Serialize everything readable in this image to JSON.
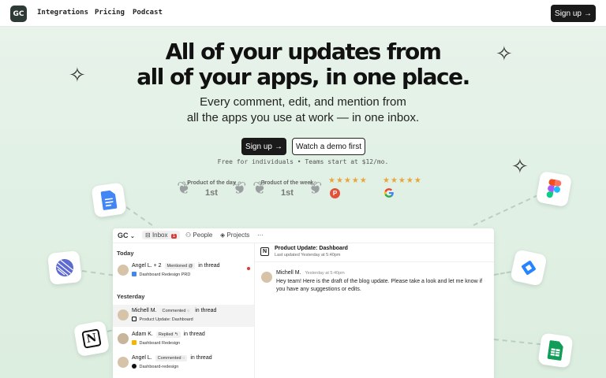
{
  "nav": {
    "logo": "GC",
    "links": [
      "Integrations",
      "Pricing",
      "Podcast"
    ],
    "signup": "Sign up",
    "arrow": "→"
  },
  "hero": {
    "title_line1": "All of your updates from",
    "title_line2": "all of your apps, in one place.",
    "sub_line1": "Every comment, edit, and mention from",
    "sub_line2": "all the apps you use at work — in one inbox.",
    "primary_cta": "Sign up",
    "secondary_cta": "Watch a demo first",
    "pricing_note": "Free for individuals • Teams start at $12/mo."
  },
  "awards": [
    {
      "title": "Product of the day",
      "rank": "1st"
    },
    {
      "title": "Product of the week",
      "rank": "1st"
    }
  ],
  "ratings": [
    {
      "stars": "★★★★★",
      "source_icon": "product-hunt-icon",
      "source_letter": "P"
    },
    {
      "stars": "★★★★★",
      "source_icon": "google-icon"
    }
  ],
  "app": {
    "logo": "GC",
    "tabs": [
      {
        "label": "Inbox",
        "badge": "1"
      },
      {
        "label": "People"
      },
      {
        "label": "Projects"
      }
    ],
    "more": "···",
    "sections": {
      "today": "Today",
      "yesterday": "Yesterday"
    },
    "items": [
      {
        "name": "Angel L. + 2",
        "action": "Mentioned @",
        "suffix": "in thread",
        "doc": "Dashboard Redesign PRD",
        "doc_icon": "google-docs-icon",
        "unread": true
      },
      {
        "name": "Michell M.",
        "action": "Commented ◌",
        "suffix": "in thread",
        "doc": "Product Update: Dashboard",
        "doc_icon": "notion-icon",
        "unread": false
      },
      {
        "name": "Adam K.",
        "action": "Replied ↰",
        "suffix": "in thread",
        "doc": "Dashboard Redesign",
        "doc_icon": "google-slides-icon",
        "unread": false
      },
      {
        "name": "Angel L.",
        "action": "Commented ◌",
        "suffix": "in thread",
        "doc": "Dashboard-redesign",
        "doc_icon": "github-icon",
        "unread": false
      }
    ],
    "detail": {
      "title": "Product Update: Dashboard",
      "subtitle": "Last updated Yesterday at 5:40pm",
      "message": {
        "author": "Michell M.",
        "time": "Yesterday at 5:40pm",
        "body": "Hey team! Here is the draft of the blog update. Please take a look and let me know if you have any suggestions or edits."
      }
    }
  },
  "floating_icons": [
    "google-docs-icon",
    "linear-icon",
    "notion-icon",
    "figma-icon",
    "jira-icon",
    "google-sheets-icon"
  ],
  "colors": {
    "accent": "#1a1a1a",
    "bg": "#e2f1e6",
    "star": "#e9a53a",
    "badge": "#d93b3b"
  }
}
